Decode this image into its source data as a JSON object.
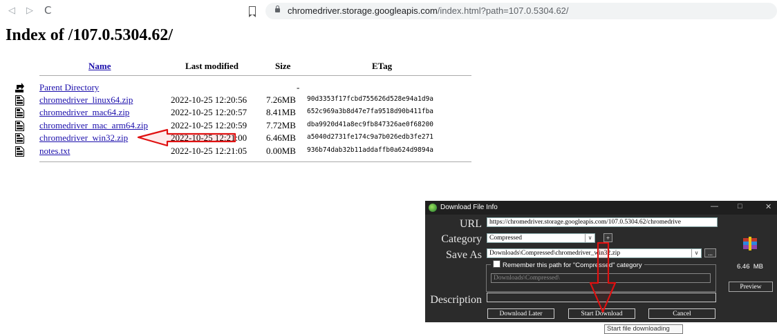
{
  "browser": {
    "back_icon": "back-arrow-icon",
    "forward_icon": "forward-arrow-icon",
    "reload_icon": "reload-icon",
    "url_host": "chromedriver.storage.googleapis.com",
    "url_rest": "/index.html?path=107.0.5304.62/"
  },
  "page": {
    "title": "Index of /107.0.5304.62/",
    "columns": [
      "Name",
      "Last modified",
      "Size",
      "ETag"
    ],
    "parent": {
      "name": "Parent Directory",
      "size": "-"
    },
    "files": [
      {
        "name": "chromedriver_linux64.zip",
        "modified": "2022-10-25 12:20:56",
        "size": "7.26MB",
        "etag": "90d3353f17fcbd755626d528e94a1d9a"
      },
      {
        "name": "chromedriver_mac64.zip",
        "modified": "2022-10-25 12:20:57",
        "size": "8.41MB",
        "etag": "652c969a3b8d47e7fa9518d90b411fba"
      },
      {
        "name": "chromedriver_mac_arm64.zip",
        "modified": "2022-10-25 12:20:59",
        "size": "7.72MB",
        "etag": "dba9920d41a8ec9fb847326ae0f68200"
      },
      {
        "name": "chromedriver_win32.zip",
        "modified": "2022-10-25 12:21:00",
        "size": "6.46MB",
        "etag": "a5040d2731fe174c9a7b026edb3fe271"
      },
      {
        "name": "notes.txt",
        "modified": "2022-10-25 12:21:05",
        "size": "0.00MB",
        "etag": "936b74dab32b11addaffb0a624d9894a"
      }
    ]
  },
  "dialog": {
    "title": "Download File Info",
    "url_label": "URL",
    "url_value": "https://chromedriver.storage.googleapis.com/107.0.5304.62/chromedrive",
    "category_label": "Category",
    "category_value": "Compressed",
    "add_label": "+",
    "save_as_label": "Save As",
    "save_as_value": "Downloads\\Compressed\\chromedriver_win32.zip",
    "browse_label": "...",
    "remember_label": "Remember this path for \"Compressed\" category",
    "remember_path": "Downloads\\Compressed\\",
    "description_label": "Description",
    "description_value": "",
    "file_size": "6.46  MB",
    "preview_label": "Preview",
    "download_later_label": "Download Later",
    "start_download_label": "Start Download",
    "cancel_label": "Cancel",
    "minimize": "—",
    "maximize": "□",
    "close": "✕"
  },
  "tooltip": "Start file downloading",
  "colors": {
    "link": "#1a0dab",
    "annotation": "#e01010",
    "dialog_bg": "#2b2b2b"
  }
}
